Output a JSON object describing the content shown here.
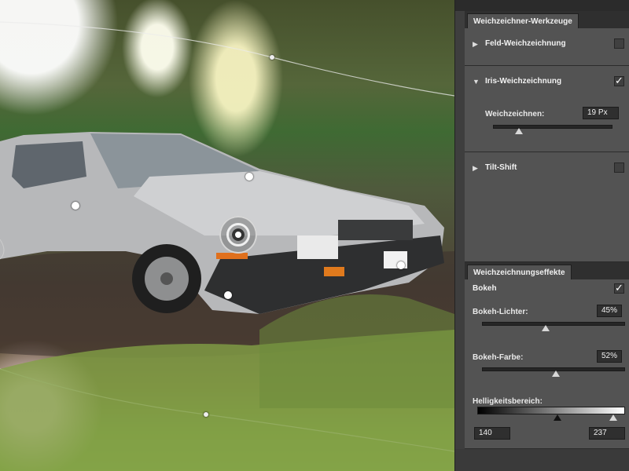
{
  "panel1": {
    "title": "Weichzeichner-Werkzeuge",
    "field_blur": {
      "label": "Feld-Weichzeichnung",
      "checked": false
    },
    "iris_blur": {
      "label": "Iris-Weichzeichnung",
      "checked": true,
      "blur_label": "Weichzeichnen:",
      "blur_value": "19 Px",
      "blur_level": 0.22
    },
    "tilt_shift": {
      "label": "Tilt-Shift",
      "checked": false
    }
  },
  "panel2": {
    "title": "Weichzeichnungseffekte",
    "bokeh": {
      "label": "Bokeh",
      "checked": true
    },
    "bokeh_light": {
      "label": "Bokeh-Lichter:",
      "value": "45%",
      "level": 0.45
    },
    "bokeh_color": {
      "label": "Bokeh-Farbe:",
      "value": "52%",
      "level": 0.52
    },
    "brightness_range": {
      "label": "Helligkeitsbereich:",
      "low": "140",
      "high": "237",
      "low_value": 140,
      "high_value": 237
    }
  },
  "icons": {
    "expand": "triangle-right-icon",
    "collapse": "triangle-down-icon",
    "check": "checkmark-icon"
  }
}
